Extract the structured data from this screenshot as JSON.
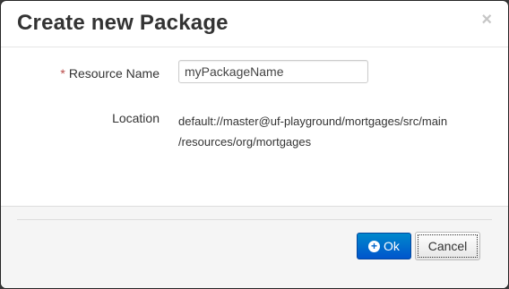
{
  "dialog": {
    "title": "Create new Package",
    "close_glyph": "×"
  },
  "form": {
    "resource_name": {
      "required_marker": "*",
      "label": "Resource Name",
      "value": "myPackageName"
    },
    "location": {
      "label": "Location",
      "value_lines": [
        "default://master@uf-playground/mortgages/src/main",
        "/resources/org/mortgages"
      ]
    }
  },
  "footer": {
    "ok_label": "Ok",
    "ok_icon": "plus-circle-icon",
    "cancel_label": "Cancel"
  },
  "colors": {
    "primary": "#0066cc",
    "required": "#b94a48"
  }
}
